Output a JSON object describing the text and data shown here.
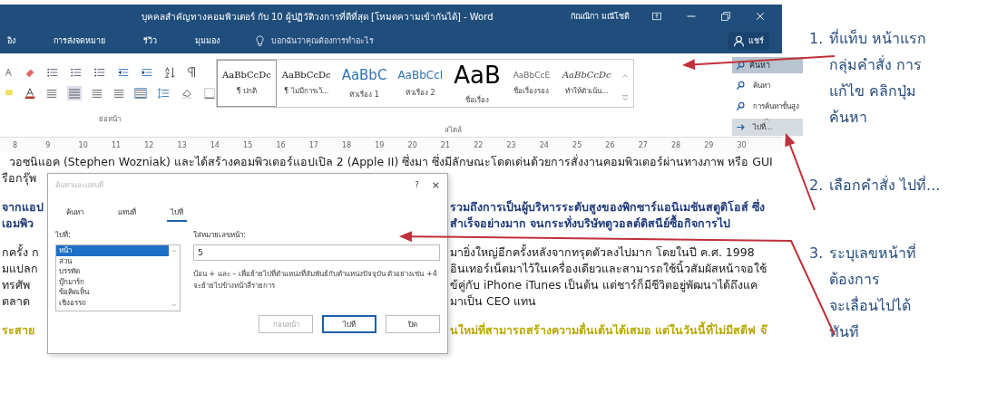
{
  "window": {
    "title": "บุคคลสำคัญทางคอมพิวเตอร์ กับ 10 ผู้ปฏิวัติวงการที่ดีที่สุด [โหมดความเข้ากันได้] - Word",
    "user": "กัณณิกา มณีโชติ"
  },
  "ribbon_tabs": [
    {
      "label": "อิง",
      "selected": false
    },
    {
      "label": "การส่งจดหมาย",
      "selected": false
    },
    {
      "label": "รีวิว",
      "selected": false
    },
    {
      "label": "มุมมอง",
      "selected": false
    }
  ],
  "tell_me": {
    "placeholder": "บอกฉันว่าคุณต้องการทำอะไร"
  },
  "share_button": "แชร์",
  "styles": [
    {
      "kind": "normal",
      "sample": "AaBbCcDc",
      "label": "¶ ปกติ",
      "selected": true
    },
    {
      "kind": "normal",
      "sample": "AaBbCcDc",
      "label": "¶ ไม่มีการเว้...",
      "selected": false
    },
    {
      "kind": "heading1",
      "sample": "AaBbC",
      "label": "หัวเรื่อง 1",
      "selected": false
    },
    {
      "kind": "heading2",
      "sample": "AaBbCcI",
      "label": "หัวเรื่อง 2",
      "selected": false
    },
    {
      "kind": "title",
      "sample": "AaB",
      "label": "ชื่อเรื่อง",
      "selected": false
    },
    {
      "kind": "subtitle",
      "sample": "AaBbCcE",
      "label": "ชื่อเรื่องรอง",
      "selected": false
    },
    {
      "kind": "emphasis",
      "sample": "AaBbCcDc",
      "label": "ทำให้ตัวเน้น...",
      "selected": false
    }
  ],
  "group_labels": [
    "ย่อหน้า",
    "สไตล์"
  ],
  "find_button": {
    "label": "ค้นหา",
    "expanded": true
  },
  "find_menu": [
    {
      "label": "ค้นหา",
      "selected": false
    },
    {
      "label": "การค้นหาขั้นสูง",
      "selected": false
    },
    {
      "label": "ไปที่...",
      "selected": true
    }
  ],
  "ruler": [
    "8",
    "9",
    "10",
    "11",
    "12",
    "13",
    "14",
    "15",
    "16",
    "17",
    "18",
    "19",
    "20",
    "21",
    "22",
    "23",
    "24",
    "25",
    "26",
    "27",
    "28",
    "29",
    "30"
  ],
  "document": {
    "lines": [
      {
        "kind": "black",
        "text": "วอซนิแอค (Stephen Wozniak) และได้สร้างคอมพิวเตอร์แอปเปิล 2 (Apple II) ซึ่งมา ซึ่งมีลักษณะโดดเด่นด้วยการสั่งงานคอมพิวเตอร์ผ่านทางภาพ หรือ GUI"
      },
      {
        "kind": "black",
        "left": "รือกรุ๊พ"
      },
      {
        "kind": "blue",
        "left": "จากแอป",
        "right": "รวมถึงการเป็นผู้บริหารระดับสูงของพิกซาร์แอนิเมชันสตูดิโอส์ ซึ่ง"
      },
      {
        "kind": "blue",
        "left": "เอมพิว",
        "right": "สำเร็จอย่างมาก จนกระทั่งบริษัทดูวอลต์ดิสนีย์ซื้อกิจการไป"
      },
      {
        "kind": "black",
        "left": "กครั้ง ก",
        "right": "มายิ่งใหญ่อีกครั้งหลังจากทรุดตัวลงไปมาก โดยในปี ค.ศ. 1998"
      },
      {
        "kind": "black",
        "left": "มแปลก",
        "right": "อินเทอร์เน็ตมาไว้ในเครื่องเดียวและสามารถใช้นิ้วสัมผัสหน้าจอใช้"
      },
      {
        "kind": "black",
        "left": "ทรศัพ",
        "right": "ข้คู่กับ iPhone iTunes เป็นต้น แต่ชาร์ก็มีชีวิตอยู่พัฒนาได้ถึงแค"
      },
      {
        "kind": "black",
        "left": "ตลาด",
        "right": "มาเป็น CEO แทน"
      },
      {
        "kind": "yellow",
        "left": "ระสาย",
        "right": "นใหม่ที่สามารถสร้างความตื่นเต้นได้เสมอ แต่ในวันนี้ที่ไม่มีสตีฟ จ๊"
      }
    ]
  },
  "dialog": {
    "title": "ค้นหาและแทนที่",
    "help": "?",
    "close": "×",
    "tabs": [
      {
        "label": "ค้นหา",
        "selected": false
      },
      {
        "label": "แทนที่",
        "selected": false
      },
      {
        "label": "ไปที่",
        "selected": true
      }
    ],
    "goto_label": "ไปที่:",
    "goto_items": [
      {
        "label": "หน้า",
        "selected": true
      },
      {
        "label": "ส่วน",
        "selected": false
      },
      {
        "label": "บรรทัด",
        "selected": false
      },
      {
        "label": "บุ๊กมาร์ก",
        "selected": false
      },
      {
        "label": "ข้อคิดเห็น",
        "selected": false
      },
      {
        "label": "เชิงอรรถ",
        "selected": false
      }
    ],
    "field_label": "ใส่หมายเลขหน้า:",
    "field_value": "5",
    "hint": "ป้อน + และ – เพื่อย้ายไปที่ตำแหน่งที่สัมพันธ์กับตำแหน่งปัจจุบัน ตัวอย่างเช่น +4 จะย้ายไปข้างหน้าสี่รายการ",
    "buttons": [
      {
        "label": "ก่อนหน้า",
        "disabled": true,
        "default": false
      },
      {
        "label": "ไปที่",
        "disabled": false,
        "default": true
      },
      {
        "label": "ปิด",
        "disabled": false,
        "default": false
      }
    ]
  },
  "notes": [
    {
      "number": "1.",
      "lines": [
        "ที่แท็บ หน้าแรก",
        "กลุ่มคำสั่ง การ",
        "แก้ไข คลิกปุ่ม",
        "ค้นหา"
      ]
    },
    {
      "number": "2.",
      "lines": [
        "เลือกคำสั่ง ไปที่..."
      ]
    },
    {
      "number": "3.",
      "lines": [
        "ระบุเลขหน้าที่",
        "ต้องการ",
        "จะเลื่อนไปได้",
        "ทันที"
      ]
    }
  ]
}
